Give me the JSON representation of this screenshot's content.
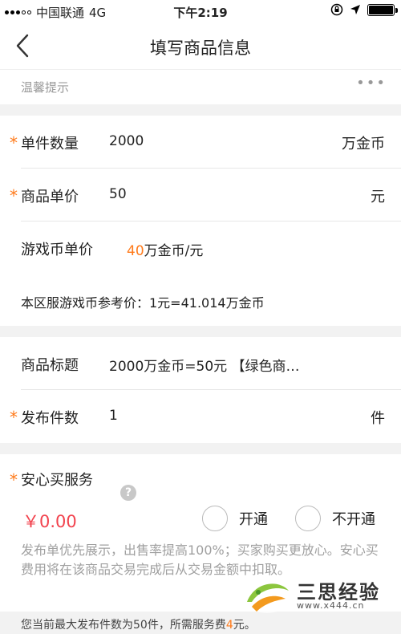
{
  "status_bar": {
    "carrier": "中国联通",
    "network": "4G",
    "time": "下午2:19"
  },
  "nav": {
    "title": "填写商品信息"
  },
  "tip": {
    "label": "温馨提示",
    "more": "•••"
  },
  "form": {
    "quantity": {
      "required_mark": "*",
      "label": "单件数量",
      "value": "2000",
      "unit": "万金币"
    },
    "unit_price": {
      "required_mark": "*",
      "label": "商品单价",
      "value": "50",
      "unit": "元"
    },
    "coin_price": {
      "label": "游戏币单价",
      "value": "40",
      "suffix": "万金币/元"
    },
    "reference_price": {
      "text": "本区服游戏币参考价：1元=41.014万金币"
    },
    "title": {
      "label": "商品标题",
      "value": "2000万金币=50元 【绿色商…"
    },
    "publish_count": {
      "required_mark": "*",
      "label": "发布件数",
      "value": "1",
      "unit": "件"
    }
  },
  "service": {
    "required_mark": "*",
    "label": "安心买服务",
    "help_icon": "?",
    "price": "￥0.00",
    "options": [
      {
        "label": "开通",
        "selected": false
      },
      {
        "label": "不开通",
        "selected": false
      }
    ],
    "description": "发布单优先展示，出售率提高100%；买家购买更放心。安心买费用将在该商品交易完成后从交易金额中扣取。"
  },
  "footer": {
    "text_before": "您当前最大发布件数为50件，所需服务费",
    "fee": "4",
    "text_after": "元。"
  },
  "watermark": {
    "name": "三思经验",
    "url": "www.x444.cn"
  },
  "colors": {
    "accent": "#ff7a1a",
    "price_red": "#f2434e",
    "muted": "#a0a0a0",
    "background": "#f2f2f2"
  }
}
